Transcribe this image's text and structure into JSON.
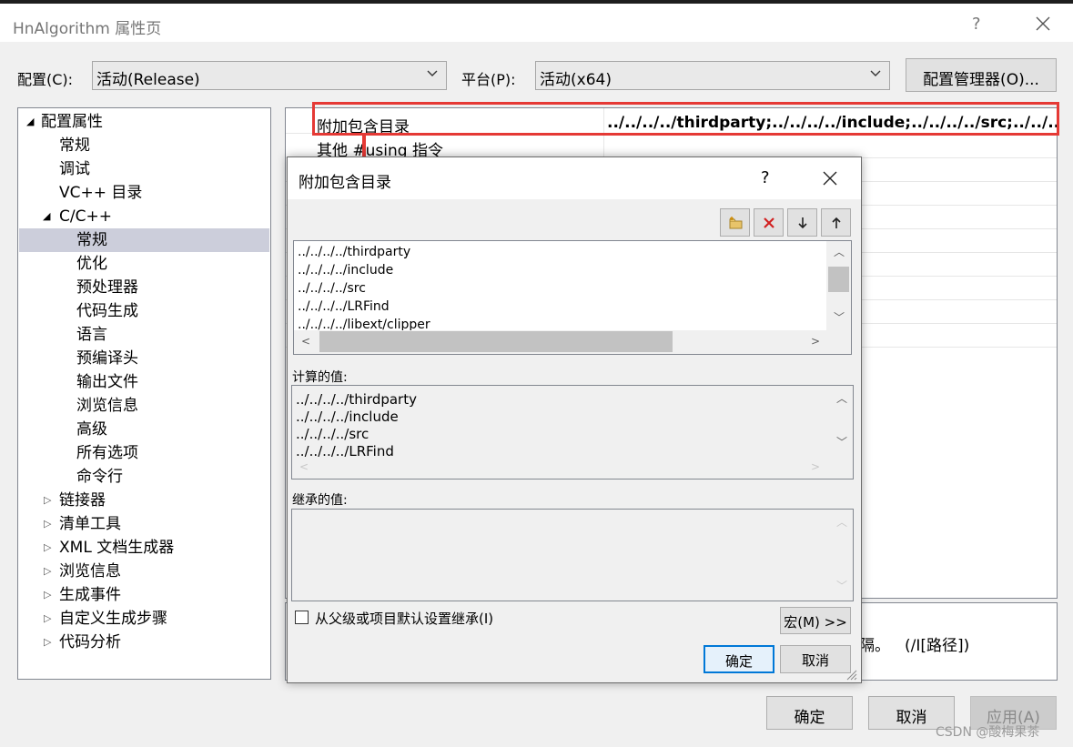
{
  "window": {
    "title": "HnAlgorithm 属性页",
    "help_glyph": "?"
  },
  "toolbar": {
    "config_label": "配置(C):",
    "config_value": "活动(Release)",
    "platform_label": "平台(P):",
    "platform_value": "活动(x64)",
    "config_manager_label": "配置管理器(O)..."
  },
  "tree": {
    "root": "配置属性",
    "items": [
      "常规",
      "调试",
      "VC++ 目录"
    ],
    "cpp_group": "C/C++",
    "cpp_items": [
      "常规",
      "优化",
      "预处理器",
      "代码生成",
      "语言",
      "预编译头",
      "输出文件",
      "浏览信息",
      "高级",
      "所有选项",
      "命令行"
    ],
    "collapsed_groups": [
      "链接器",
      "清单工具",
      "XML 文档生成器",
      "浏览信息",
      "生成事件",
      "自定义生成步骤",
      "代码分析"
    ],
    "selected": "常规"
  },
  "grid": {
    "rows": [
      {
        "name": "附加包含目录",
        "value": "../../../../thirdparty;../../../../include;../../../../src;../../../.."
      },
      {
        "name": "其他 #using 指令",
        "value": ""
      }
    ],
    "description_tail": "隔。",
    "description_switch": "(/I[路径])"
  },
  "main_buttons": {
    "ok": "确定",
    "cancel": "取消",
    "apply": "应用(A)"
  },
  "dialog": {
    "title": "附加包含目录",
    "help_glyph": "?",
    "edit_items": [
      "../../../../thirdparty",
      "../../../../include",
      "../../../../src",
      "../../../../LRFind",
      "../../../../libext/clipper"
    ],
    "evaluated_label": "计算的值:",
    "evaluated_items": [
      "../../../../thirdparty",
      "../../../../include",
      "../../../../src",
      "../../../../LRFind"
    ],
    "inherited_label": "继承的值:",
    "inherit_checkbox_label": "从父级或项目默认设置继承(I)",
    "inherit_checked": false,
    "macros_button": "宏(M) >>",
    "ok": "确定",
    "cancel": "取消"
  },
  "watermark": "CSDN @酸梅果茶",
  "colors": {
    "accent": "#0078d7",
    "highlight": "#e53935",
    "selection": "#cccedb"
  }
}
